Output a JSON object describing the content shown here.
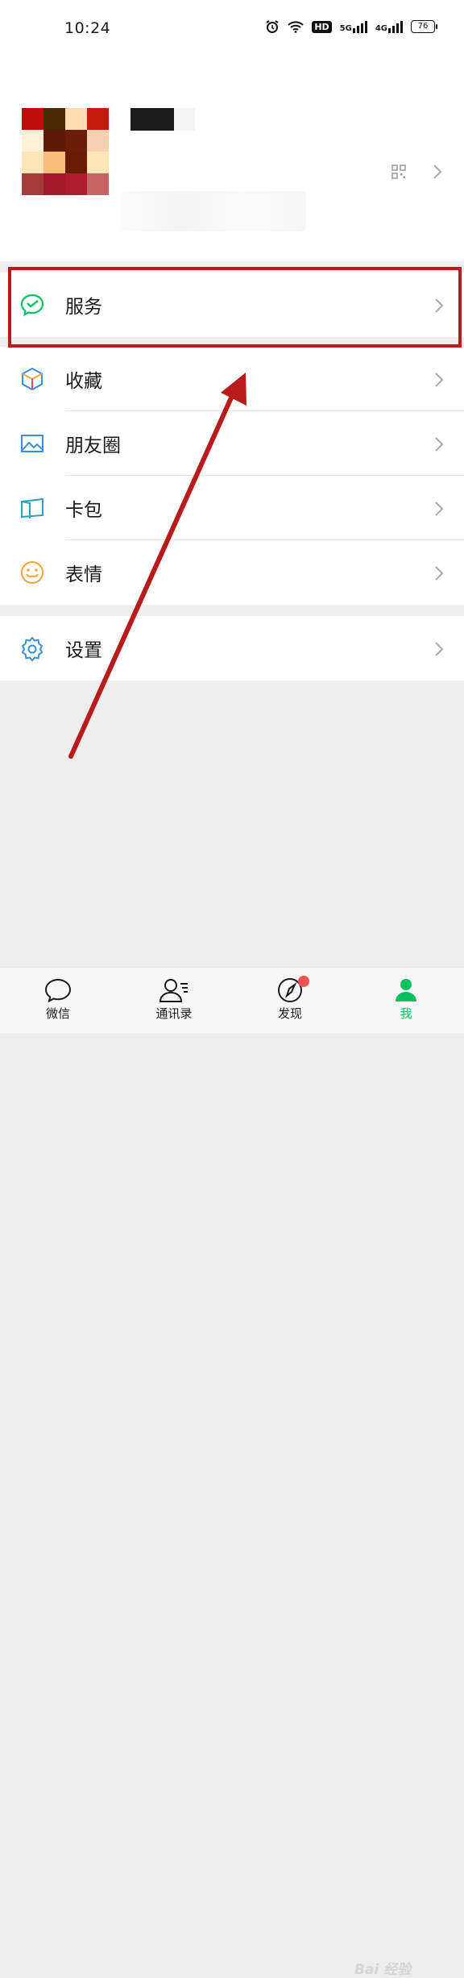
{
  "status_bar": {
    "time": "10:24",
    "hd_label": "HD",
    "net1": "5G",
    "net2": "4G",
    "battery": "76"
  },
  "colors": {
    "accent": "#07c160",
    "highlight": "#b81b1b",
    "badge": "#fa5151"
  },
  "menu": {
    "group1": [
      {
        "label": "服务",
        "icon": "wechat-pay-icon"
      }
    ],
    "group2": [
      {
        "label": "收藏",
        "icon": "favorites-cube-icon"
      },
      {
        "label": "朋友圈",
        "icon": "moments-image-icon"
      },
      {
        "label": "卡包",
        "icon": "card-wallet-icon"
      },
      {
        "label": "表情",
        "icon": "sticker-smile-icon"
      }
    ],
    "group3": [
      {
        "label": "设置",
        "icon": "settings-gear-icon"
      }
    ]
  },
  "tabs": [
    {
      "label": "微信",
      "icon": "chat-bubble-icon"
    },
    {
      "label": "通讯录",
      "icon": "contacts-icon"
    },
    {
      "label": "发现",
      "icon": "compass-icon"
    },
    {
      "label": "我",
      "icon": "me-person-icon"
    }
  ],
  "watermark": "Bai 经验"
}
